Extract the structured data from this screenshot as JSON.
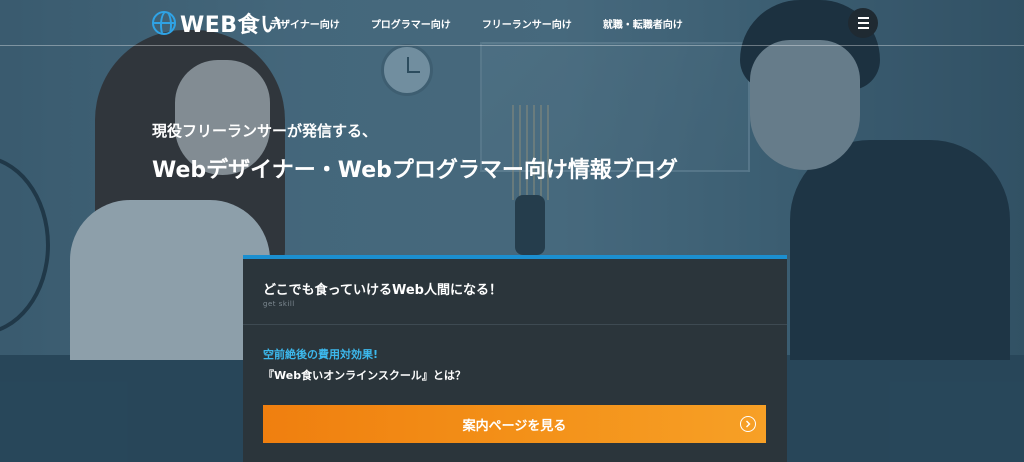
{
  "header": {
    "logo_text": "WEB食い",
    "logo_icon": "globe-icon",
    "nav": [
      {
        "label": "デザイナー向け"
      },
      {
        "label": "プログラマー向け"
      },
      {
        "label": "フリーランサー向け"
      },
      {
        "label": "就職・転職者向け"
      }
    ],
    "menu_icon": "hamburger-menu-icon"
  },
  "hero": {
    "subtitle": "現役フリーランサーが発信する、",
    "title": "Webデザイナー・Webプログラマー向け情報ブログ"
  },
  "card": {
    "title": "どこでも食っていけるWeb人間になる！",
    "subtitle": "get skill",
    "accent": "空前絶後の費用対効果!",
    "text": "『Web食いオンラインスクール』とは？",
    "cta_label": "案内ページを見る",
    "cta_icon": "chevron-right-circle-icon"
  },
  "colors": {
    "accent_blue": "#1b8fd0",
    "link_blue": "#3cb8ec",
    "cta_orange": "#f39018",
    "card_bg": "#2b353b"
  }
}
